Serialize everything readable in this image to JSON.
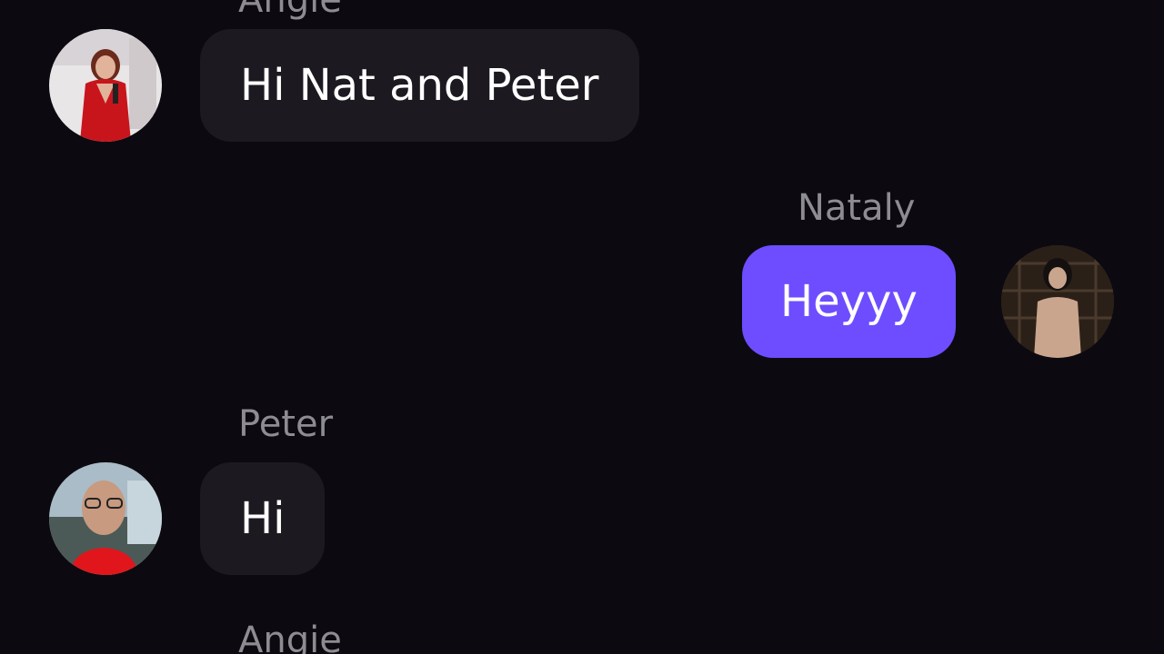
{
  "messages": [
    {
      "sender": "Angie",
      "text": "Hi Nat and Peter",
      "side": "left",
      "avatar_icon": "angie-avatar"
    },
    {
      "sender": "Nataly",
      "text": "Heyyy",
      "side": "right",
      "avatar_icon": "nataly-avatar"
    },
    {
      "sender": "Peter",
      "text": "Hi",
      "side": "left",
      "avatar_icon": "peter-avatar"
    },
    {
      "sender": "Angie"
    }
  ],
  "colors": {
    "background": "#0c0a10",
    "incoming_bubble": "#1c1a20",
    "outgoing_bubble": "#6d4dff",
    "sender_name": "#8d8c92",
    "message_text": "#ffffff"
  }
}
